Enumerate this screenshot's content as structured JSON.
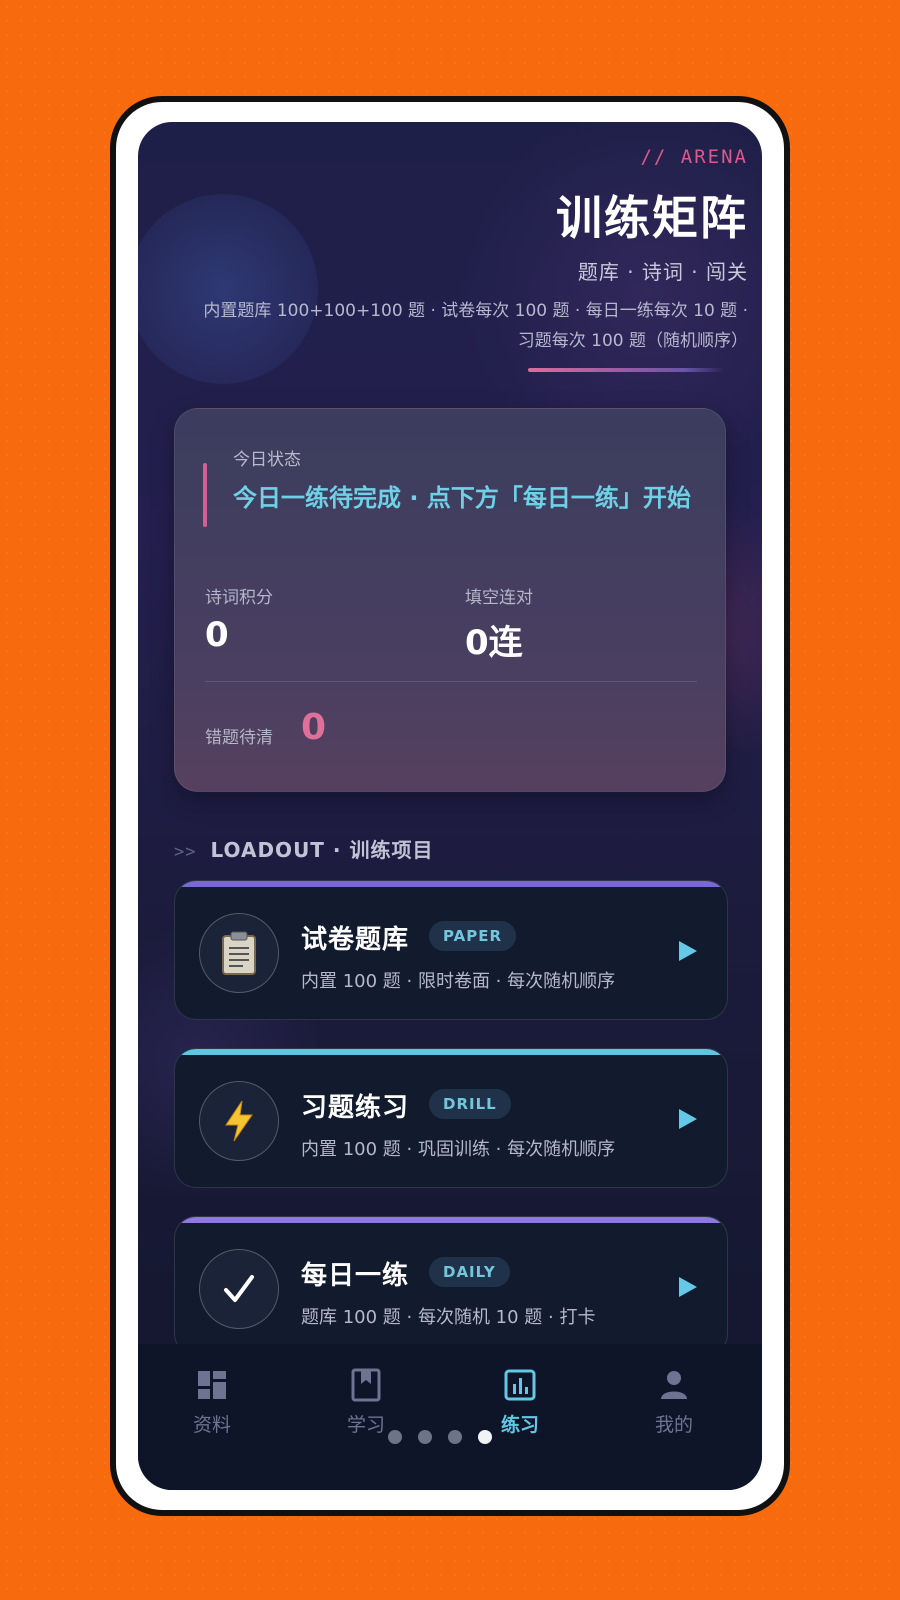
{
  "hero": {
    "tag": "// ARENA",
    "title": "训练矩阵",
    "subtitle": "题库 · 诗词 · 闯关",
    "description": "内置题库 100+100+100 题 · 试卷每次 100 题 · 每日一练每次 10 题 · 习题每次 100 题（随机顺序）"
  },
  "status": {
    "label": "今日状态",
    "text": "今日一练待完成 · 点下方「每日一练」开始",
    "poetry_label": "诗词积分",
    "poetry_value": "0",
    "streak_label": "填空连对",
    "streak_value": "0连",
    "wrong_label": "错题待清",
    "wrong_value": "0"
  },
  "section": {
    "arrow": ">>",
    "title": "LOADOUT · 训练项目"
  },
  "items": [
    {
      "title": "试卷题库",
      "tag": "PAPER",
      "desc": "内置 100 题 · 限时卷面 · 每次随机顺序",
      "icon": "clipboard-icon",
      "glyph": "📋",
      "color": "#7a68d8"
    },
    {
      "title": "习题练习",
      "tag": "DRILL",
      "desc": "内置 100 题 · 巩固训练 · 每次随机顺序",
      "icon": "lightning-icon",
      "glyph": "⚡",
      "color": "#5fc6e2"
    },
    {
      "title": "每日一练",
      "tag": "DAILY",
      "desc": "题库 100 题 · 每次随机 10 题 · 打卡",
      "icon": "check-icon",
      "glyph": "✓",
      "color": "#8f78e0"
    }
  ],
  "tabs": [
    {
      "label": "资料",
      "icon": "grid-icon",
      "active": false
    },
    {
      "label": "学习",
      "icon": "book-icon",
      "active": false
    },
    {
      "label": "练习",
      "icon": "chart-icon",
      "active": true
    },
    {
      "label": "我的",
      "icon": "person-icon",
      "active": false
    }
  ],
  "pager": {
    "count": 4,
    "active_index": 3
  },
  "colors": {
    "background": "#f86a0e",
    "accent_cyan": "#62c8e5",
    "accent_pink": "#d75e92"
  }
}
